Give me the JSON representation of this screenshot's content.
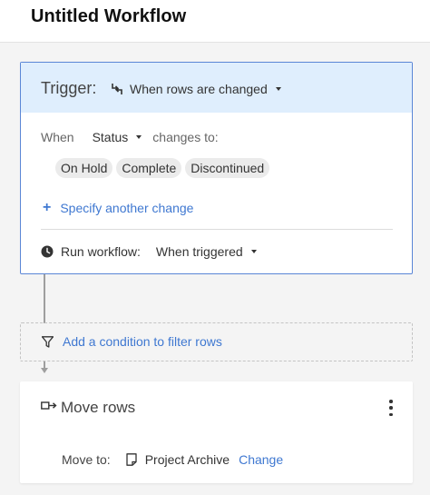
{
  "header": {
    "title": "Untitled Workflow"
  },
  "trigger": {
    "label": "Trigger:",
    "event": "When rows are changed",
    "event_icon": "swap-arrows-icon",
    "when_label": "When",
    "field": "Status",
    "changes_label": "changes to:",
    "values": [
      "On Hold",
      "Complete",
      "Discontinued"
    ],
    "specify_link": "Specify another change",
    "run_label": "Run workflow:",
    "run_value": "When triggered"
  },
  "condition": {
    "link": "Add a condition to filter rows"
  },
  "action": {
    "title": "Move rows",
    "move_label": "Move to:",
    "sheet": "Project Archive",
    "change_link": "Change"
  },
  "colors": {
    "accent": "#3f78d1",
    "trigger_header_bg": "#dfeefd",
    "trigger_border": "#5a86d6",
    "page_bg": "#f4f4f4"
  }
}
